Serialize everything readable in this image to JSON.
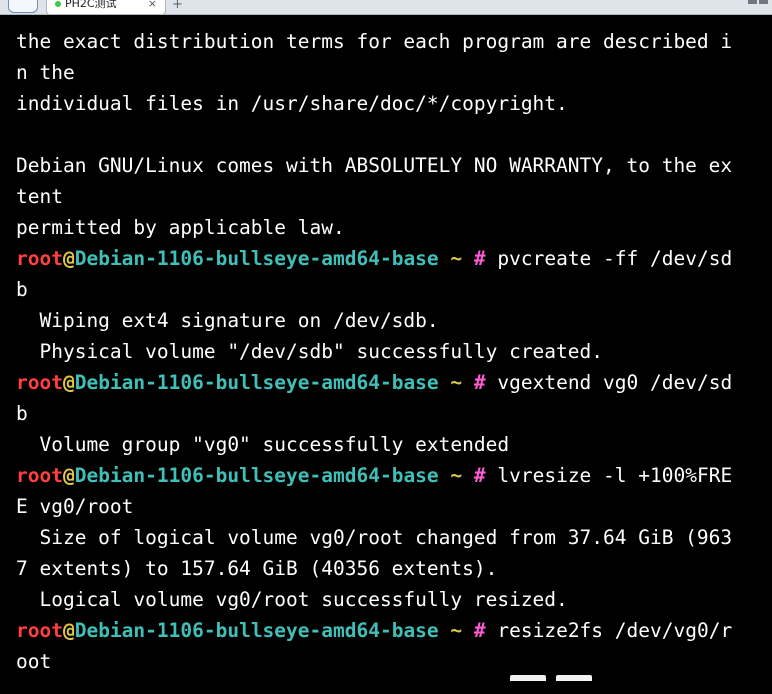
{
  "tab": {
    "title": "PH2C测试",
    "close": "×",
    "add": "+",
    "status_color": "#3cc84a"
  },
  "prompt": {
    "user": "root",
    "at": "@",
    "host": "Debian-1106-bullseye-amd64-base",
    "tilde": " ~",
    "hash": " #",
    "colors": {
      "user": "#ff4040",
      "host": "#3fbfb8",
      "tilde": "#e0c84a",
      "hash": "#ff5bd6"
    }
  },
  "terminal": {
    "lines": [
      "the exact distribution terms for each program are described i",
      "n the",
      "individual files in /usr/share/doc/*/copyright.",
      "",
      "Debian GNU/Linux comes with ABSOLUTELY NO WARRANTY, to the ex",
      "tent",
      "permitted by applicable law.",
      " pvcreate -ff /dev/sd",
      "b",
      "  Wiping ext4 signature on /dev/sdb.",
      "  Physical volume \"/dev/sdb\" successfully created.",
      " vgextend vg0 /dev/sd",
      "b",
      "  Volume group \"vg0\" successfully extended",
      " lvresize -l +100%FRE",
      "E vg0/root",
      "  Size of logical volume vg0/root changed from 37.64 GiB (963",
      "7 extents) to 157.64 GiB (40356 extents).",
      "  Logical volume vg0/root successfully resized.",
      " resize2fs /dev/vg0/r",
      "oot"
    ]
  }
}
